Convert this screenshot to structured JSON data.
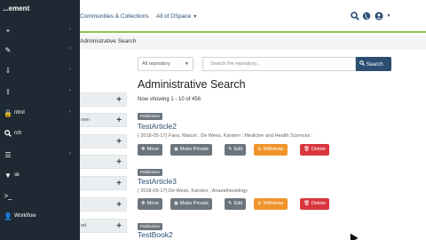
{
  "header": {
    "nav": [
      {
        "label": "Communities & Collections"
      },
      {
        "label": "All of DSpace"
      }
    ],
    "icons": [
      "search-icon",
      "globe-icon",
      "user-icon"
    ]
  },
  "breadcrumb": {
    "text": "Administrative Search"
  },
  "sidebar": {
    "brand": "...ement",
    "items": [
      {
        "icon": "plus-icon",
        "label": ""
      },
      {
        "icon": "pencil-icon",
        "label": ""
      },
      {
        "icon": "import-icon",
        "label": ""
      },
      {
        "icon": "export-icon",
        "label": ""
      },
      {
        "icon": "access-control-icon",
        "label": "ntrol"
      },
      {
        "icon": "search-icon",
        "label": "rch"
      },
      {
        "icon": "registries-icon",
        "label": ""
      },
      {
        "icon": "curation-icon",
        "label": "sk"
      },
      {
        "icon": "terminal-icon",
        "label": ""
      },
      {
        "icon": "workflow-icon",
        "label": "Workflow"
      }
    ]
  },
  "filters": [
    {
      "label": ""
    },
    {
      "label": "own"
    },
    {
      "label": ""
    },
    {
      "label": ""
    },
    {
      "label": ""
    },
    {
      "label": ""
    },
    {
      "label": "ed"
    }
  ],
  "search": {
    "scope": "All repository",
    "placeholder": "Search the repository...",
    "button": "Search"
  },
  "main": {
    "title": "Administrative Search",
    "showing": "Now showing 1 - 10 of 456"
  },
  "results": [
    {
      "badge": "Publication",
      "title": "TestArticle2",
      "meta": "( 2018-05-17) Fans, Marcel ; De Wees, Karsten ; Medicine and Health Sciences ;"
    },
    {
      "badge": "Publication",
      "title": "TestArticle3",
      "meta": "( 2018-05-17) De Wees, Karsten ; Anaesthesiology"
    },
    {
      "badge": "Publication",
      "title": "TestBook2",
      "meta": ""
    }
  ],
  "actions": {
    "move": "Move",
    "private": "Make Private",
    "edit": "Edit",
    "withdraw": "Withdraw",
    "delete": "Delete"
  }
}
